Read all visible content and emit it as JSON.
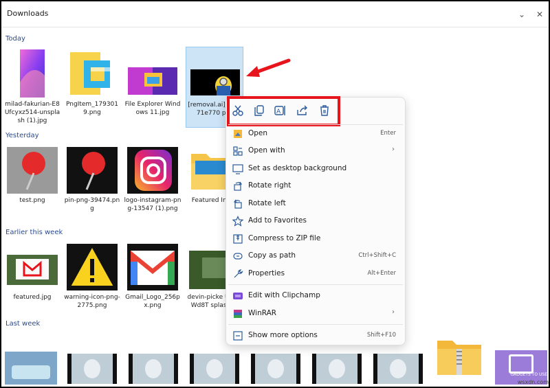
{
  "window": {
    "title": "Downloads"
  },
  "sections": {
    "today": "Today",
    "yesterday": "Yesterday",
    "earlier": "Earlier this week",
    "last_week": "Last week"
  },
  "files": {
    "today": [
      {
        "name": "milad-fakurian-E8Ufcyxz514-unsplash (1).jpg"
      },
      {
        "name": "PngItem_1793019.png"
      },
      {
        "name": "File Explorer Windows 11.jpg"
      },
      {
        "name": "[removal.ai]_-63871e770 png",
        "selected": true
      }
    ],
    "yesterday": [
      {
        "name": "test.png"
      },
      {
        "name": "pin-png-39474.png"
      },
      {
        "name": "logo-instagram-png-13547 (1).png"
      },
      {
        "name": "Featured In (2)"
      }
    ],
    "earlier": [
      {
        "name": "featured.jpg"
      },
      {
        "name": "warning-icon-png-2775.png"
      },
      {
        "name": "Gmail_Logo_256px.png"
      },
      {
        "name": "devin-picke UwQ-Wd8T splash.jp"
      }
    ]
  },
  "quick_actions": [
    {
      "icon": "cut-icon"
    },
    {
      "icon": "copy-icon"
    },
    {
      "icon": "rename-icon"
    },
    {
      "icon": "share-icon"
    },
    {
      "icon": "delete-icon"
    }
  ],
  "menu": {
    "open": {
      "label": "Open",
      "shortcut": "Enter"
    },
    "open_with": {
      "label": "Open with"
    },
    "set_bg": {
      "label": "Set as desktop background"
    },
    "rotate_right": {
      "label": "Rotate right"
    },
    "rotate_left": {
      "label": "Rotate left"
    },
    "favorites": {
      "label": "Add to Favorites"
    },
    "zip": {
      "label": "Compress to ZIP file"
    },
    "copy_path": {
      "label": "Copy as path",
      "shortcut": "Ctrl+Shift+C"
    },
    "properties": {
      "label": "Properties",
      "shortcut": "Alt+Enter"
    },
    "clipchamp": {
      "label": "Edit with Clipchamp"
    },
    "winrar": {
      "label": "WinRAR"
    },
    "more": {
      "label": "Show more options",
      "shortcut": "Shift+F10"
    }
  },
  "watermark": "GADGETS TO USE",
  "watermark2": "wsxdn.com",
  "colors": {
    "accent": "#0067c0",
    "highlight": "#e8141c",
    "selected": "#cde4f7"
  }
}
